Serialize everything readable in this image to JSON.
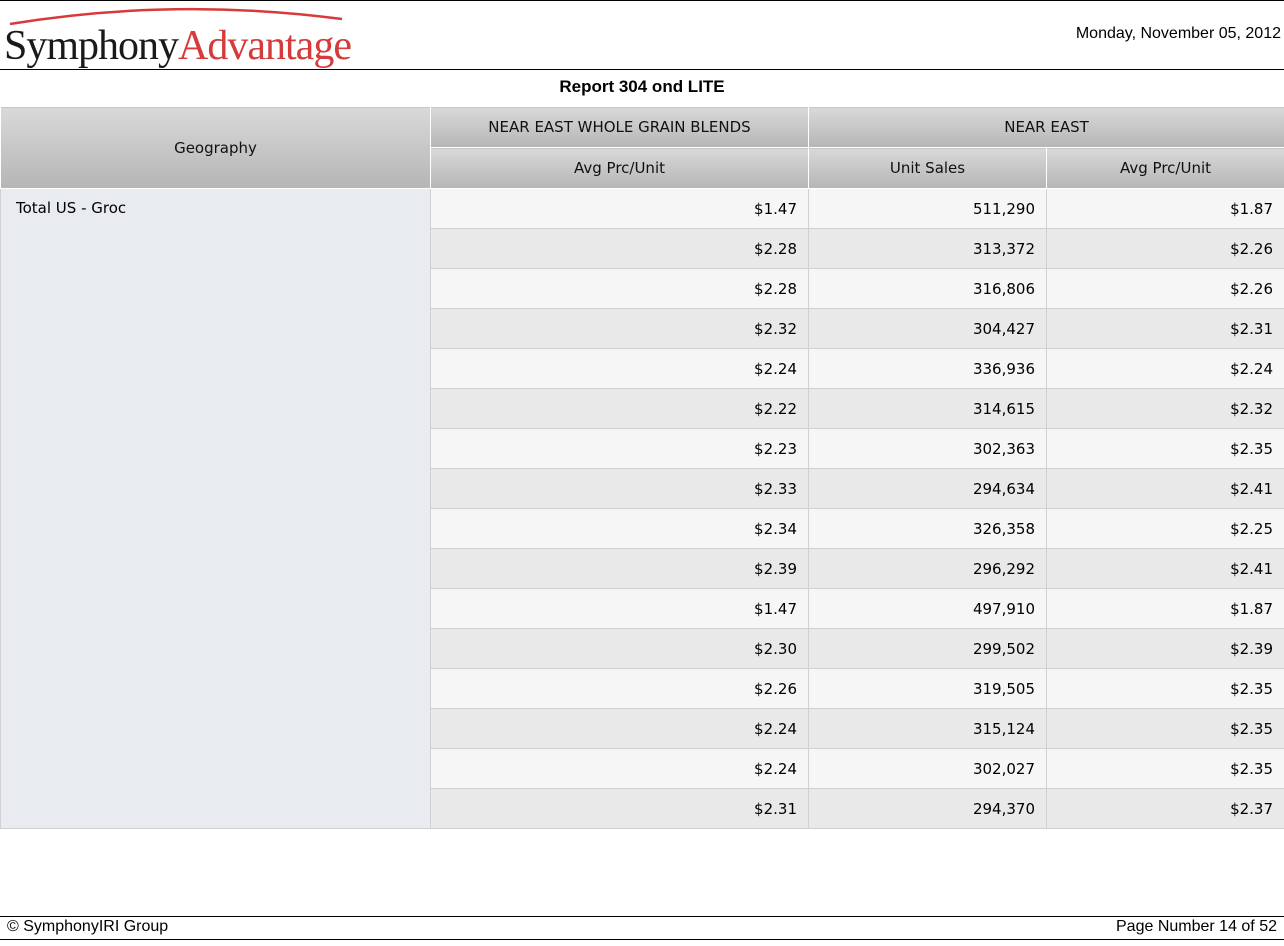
{
  "header": {
    "logo_part1": "Symphony",
    "logo_part2": "Advantage",
    "date": "Monday, November 05, 2012",
    "colors": {
      "logo_dark": "#1a1a1a",
      "logo_red": "#d63a3a"
    }
  },
  "report": {
    "title": "Report 304 ond LITE"
  },
  "table": {
    "geography_header": "Geography",
    "group_headers": [
      "NEAR EAST WHOLE GRAIN BLENDS",
      "NEAR EAST"
    ],
    "sub_headers": [
      "Avg Prc/Unit",
      "Unit Sales",
      "Avg Prc/Unit"
    ],
    "geography": "Total US - Groc",
    "rows": [
      [
        "$1.47",
        "511,290",
        "$1.87"
      ],
      [
        "$2.28",
        "313,372",
        "$2.26"
      ],
      [
        "$2.28",
        "316,806",
        "$2.26"
      ],
      [
        "$2.32",
        "304,427",
        "$2.31"
      ],
      [
        "$2.24",
        "336,936",
        "$2.24"
      ],
      [
        "$2.22",
        "314,615",
        "$2.32"
      ],
      [
        "$2.23",
        "302,363",
        "$2.35"
      ],
      [
        "$2.33",
        "294,634",
        "$2.41"
      ],
      [
        "$2.34",
        "326,358",
        "$2.25"
      ],
      [
        "$2.39",
        "296,292",
        "$2.41"
      ],
      [
        "$1.47",
        "497,910",
        "$1.87"
      ],
      [
        "$2.30",
        "299,502",
        "$2.39"
      ],
      [
        "$2.26",
        "319,505",
        "$2.35"
      ],
      [
        "$2.24",
        "315,124",
        "$2.35"
      ],
      [
        "$2.24",
        "302,027",
        "$2.35"
      ],
      [
        "$2.31",
        "294,370",
        "$2.37"
      ]
    ]
  },
  "footer": {
    "copyright": "© SymphonyIRI Group",
    "page_number": "Page Number 14 of 52"
  }
}
